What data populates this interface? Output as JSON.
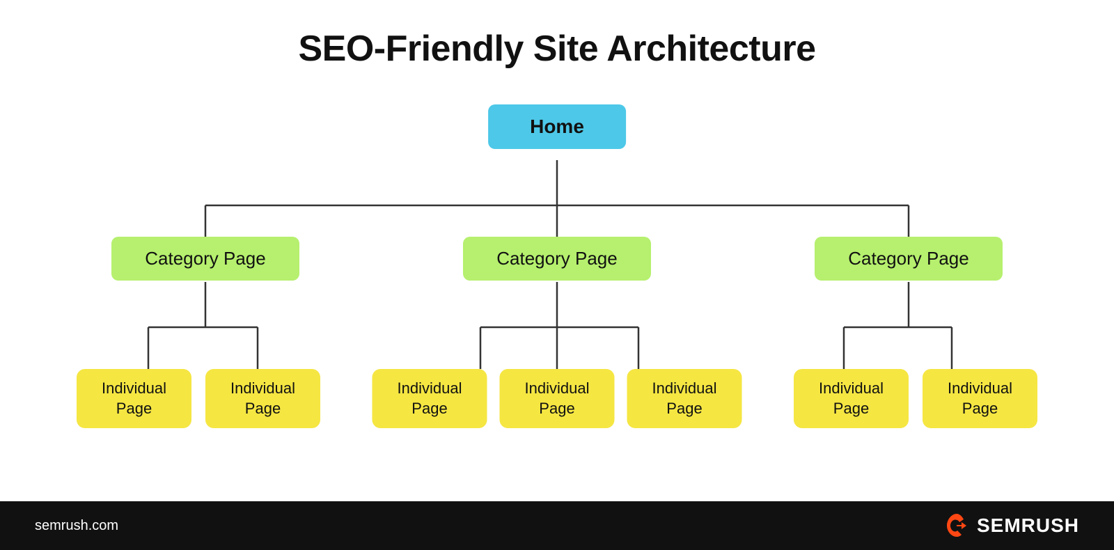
{
  "title": "SEO-Friendly Site Architecture",
  "nodes": {
    "home": "Home",
    "category_label": "Category Page",
    "individual_label": "Individual Page"
  },
  "footer": {
    "url": "semrush.com",
    "brand": "SEMRUSH"
  },
  "colors": {
    "home_bg": "#4dc8e8",
    "category_bg": "#b6f06e",
    "individual_bg": "#f5e642",
    "footer_bg": "#111111",
    "line_color": "#333333",
    "semrush_orange": "#ff4713"
  }
}
